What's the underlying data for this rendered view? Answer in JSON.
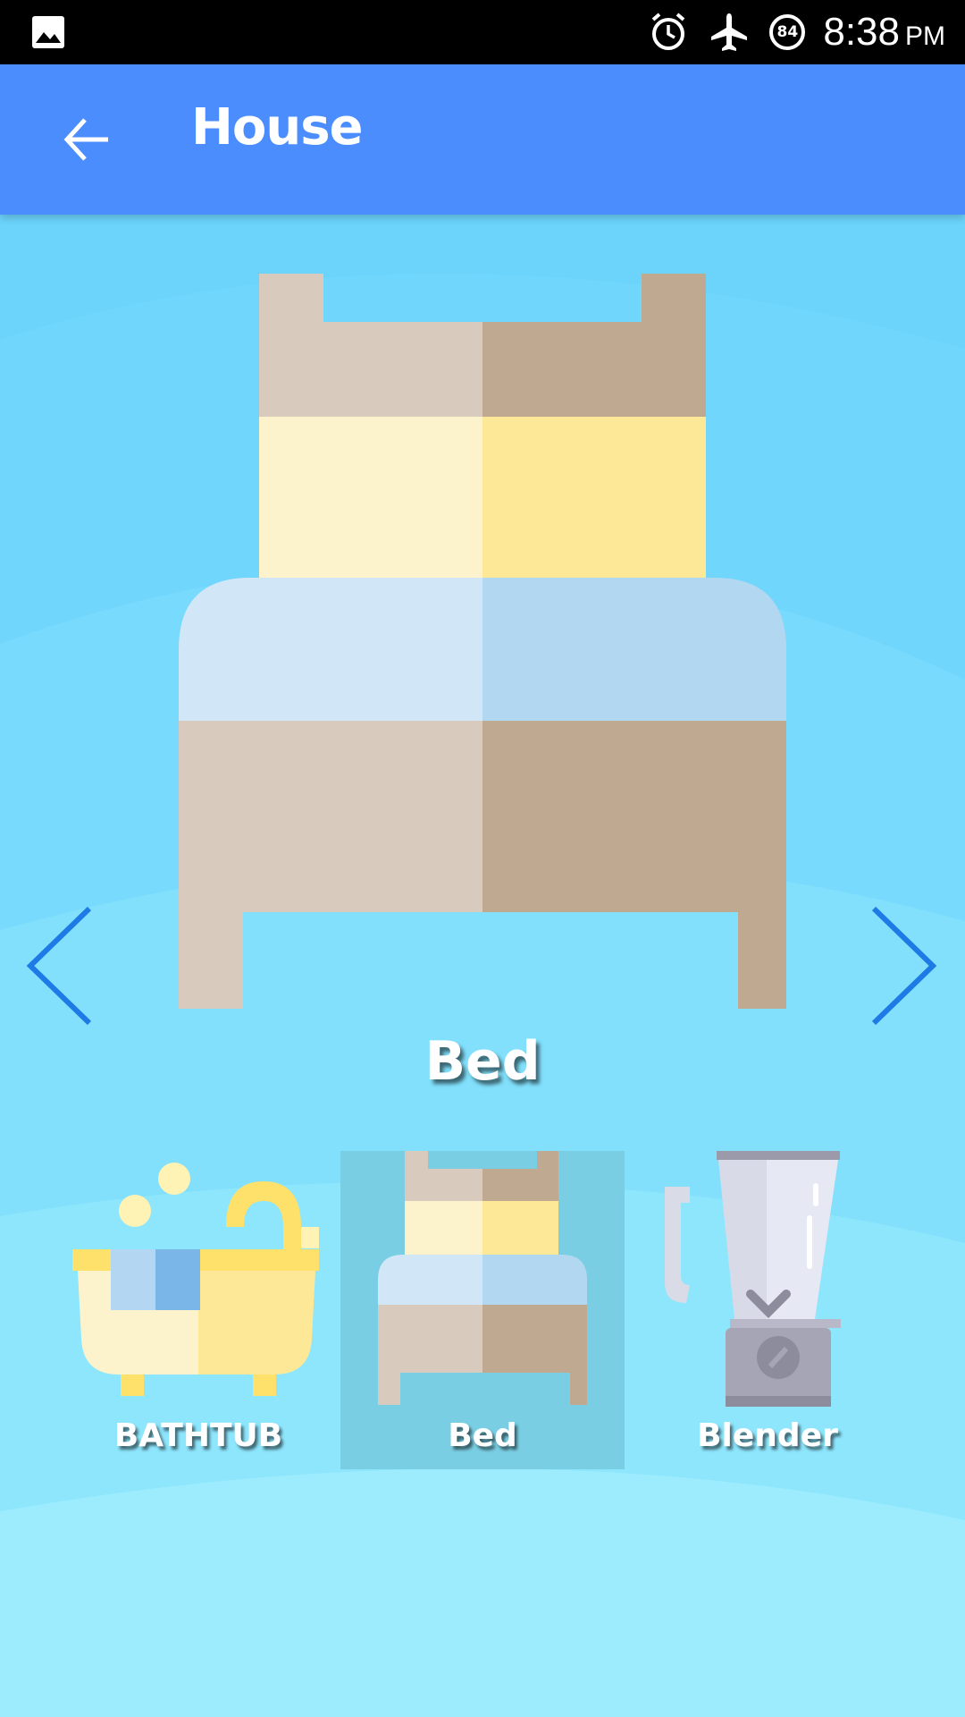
{
  "status_bar": {
    "time": "8:38",
    "ampm": "PM",
    "battery_level": "84",
    "icons": [
      "image-icon",
      "alarm-icon",
      "airplane-mode-icon",
      "battery-icon"
    ]
  },
  "app_bar": {
    "title": "House",
    "back_icon": "arrow-back-icon"
  },
  "viewer": {
    "current_item": "Bed",
    "prev_icon": "chevron-left-icon",
    "next_icon": "chevron-right-icon"
  },
  "thumbnails": [
    {
      "label": "BATHTUB",
      "icon": "bathtub-icon",
      "selected": false
    },
    {
      "label": "Bed",
      "icon": "bed-icon",
      "selected": true
    },
    {
      "label": "Blender",
      "icon": "blender-icon",
      "selected": false
    }
  ],
  "colors": {
    "app_bar": "#4b8dfc",
    "status_bar": "#000000",
    "background": "#7fdcfb",
    "selected_thumb": "#7acee3",
    "arrow": "#1e7be6"
  }
}
